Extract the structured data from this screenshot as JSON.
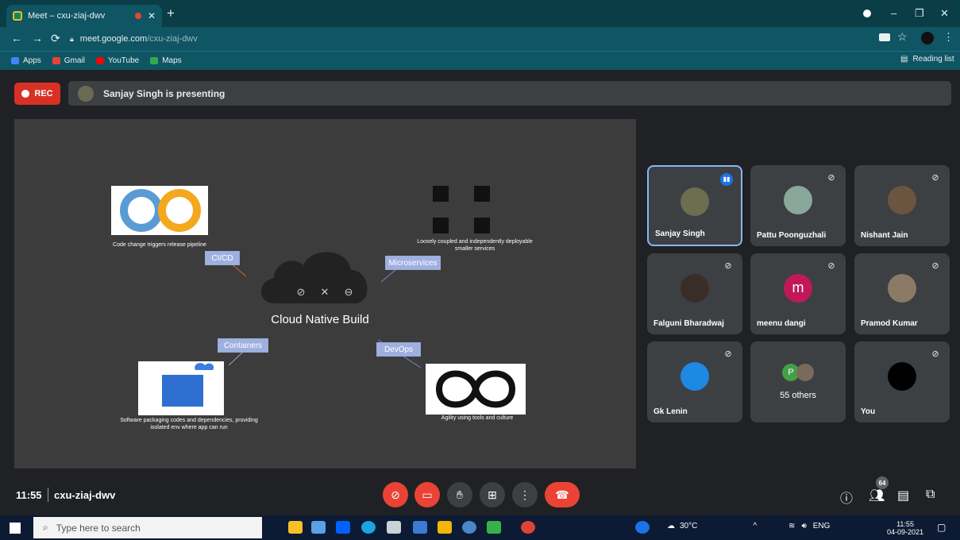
{
  "browser": {
    "tab_title": "Meet – cxu-ziaj-dwv",
    "url_host": "meet.google.com",
    "url_path": "/cxu-ziaj-dwv",
    "bookmarks": [
      "Apps",
      "Gmail",
      "YouTube",
      "Maps"
    ],
    "reading_list": "Reading list"
  },
  "meet": {
    "rec_label": "REC",
    "presenting_text": "Sanjay Singh is presenting",
    "time": "11:55",
    "code": "cxu-ziaj-dwv",
    "participant_count": "64"
  },
  "slide": {
    "center_title": "Cloud Native Build",
    "labels": {
      "cicd": "CI/CD",
      "micro": "Microservices",
      "containers": "Containers",
      "devops": "DevOps"
    },
    "captions": {
      "cicd": "Code change triggers release pipeline",
      "micro": "Loosely coupled and independently deployable smaller services",
      "containers": "Software packaging codes and dependencies, providing isolated env where app can run",
      "devops": "Agility using tools and culture"
    }
  },
  "participants": [
    {
      "name": "Sanjay Singh",
      "state": "speaking",
      "color": "#6d6d4f"
    },
    {
      "name": "Pattu Poonguzhali",
      "state": "muted",
      "color": "#8aa79b"
    },
    {
      "name": "Nishant Jain",
      "state": "muted",
      "color": "#6b5540"
    },
    {
      "name": "Falguni Bharadwaj",
      "state": "muted",
      "color": "#3a2d28"
    },
    {
      "name": "meenu dangi",
      "state": "muted",
      "initial": "m",
      "color": "#c2185b"
    },
    {
      "name": "Pramod Kumar",
      "state": "muted",
      "color": "#8b7a66"
    },
    {
      "name": "Gk Lenin",
      "state": "muted",
      "color": "#1e88e5"
    },
    {
      "name": "55 others",
      "state": "group",
      "initial": "P",
      "color": "#43a047"
    },
    {
      "name": "You",
      "state": "muted",
      "color": "#000000"
    }
  ],
  "taskbar": {
    "search_placeholder": "Type here to search",
    "weather": "30°C",
    "lang": "ENG",
    "time": "11:55",
    "date": "04-09-2021"
  }
}
